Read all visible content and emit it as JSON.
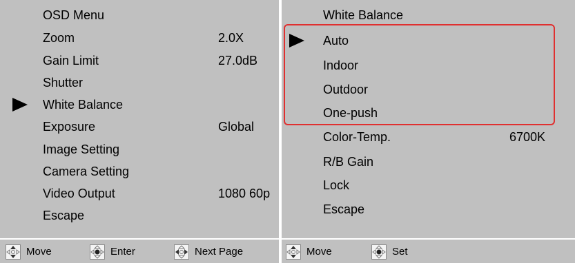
{
  "left_menu": {
    "title": "OSD Menu",
    "items": [
      {
        "label": "Zoom",
        "value": "2.0X"
      },
      {
        "label": "Gain Limit",
        "value": "27.0dB"
      },
      {
        "label": "Shutter",
        "value": ""
      },
      {
        "label": "White Balance",
        "value": "",
        "selected": true
      },
      {
        "label": "Exposure",
        "value": "Global"
      },
      {
        "label": "Image Setting",
        "value": ""
      },
      {
        "label": "Camera Setting",
        "value": ""
      },
      {
        "label": "Video Output",
        "value": "1080 60p"
      },
      {
        "label": "Escape",
        "value": ""
      }
    ],
    "footer": [
      {
        "icon": "up-down-arrows-icon",
        "label": "Move"
      },
      {
        "icon": "center-button-icon",
        "label": "Enter"
      },
      {
        "icon": "left-right-arrows-icon",
        "label": "Next Page"
      }
    ]
  },
  "right_menu": {
    "title": "White Balance",
    "items": [
      {
        "label": "Auto",
        "value": "",
        "selected": true
      },
      {
        "label": "Indoor",
        "value": ""
      },
      {
        "label": "Outdoor",
        "value": ""
      },
      {
        "label": "One-push",
        "value": ""
      },
      {
        "label": "Color-Temp.",
        "value": "6700K"
      },
      {
        "label": "R/B Gain",
        "value": ""
      },
      {
        "label": "Lock",
        "value": ""
      },
      {
        "label": "Escape",
        "value": ""
      }
    ],
    "footer": [
      {
        "icon": "up-down-arrows-icon",
        "label": "Move"
      },
      {
        "icon": "center-button-icon",
        "label": "Set"
      }
    ]
  },
  "colors": {
    "panel_bg": "#c0c0c0",
    "highlight_box": "#e03030",
    "text": "#000000"
  }
}
